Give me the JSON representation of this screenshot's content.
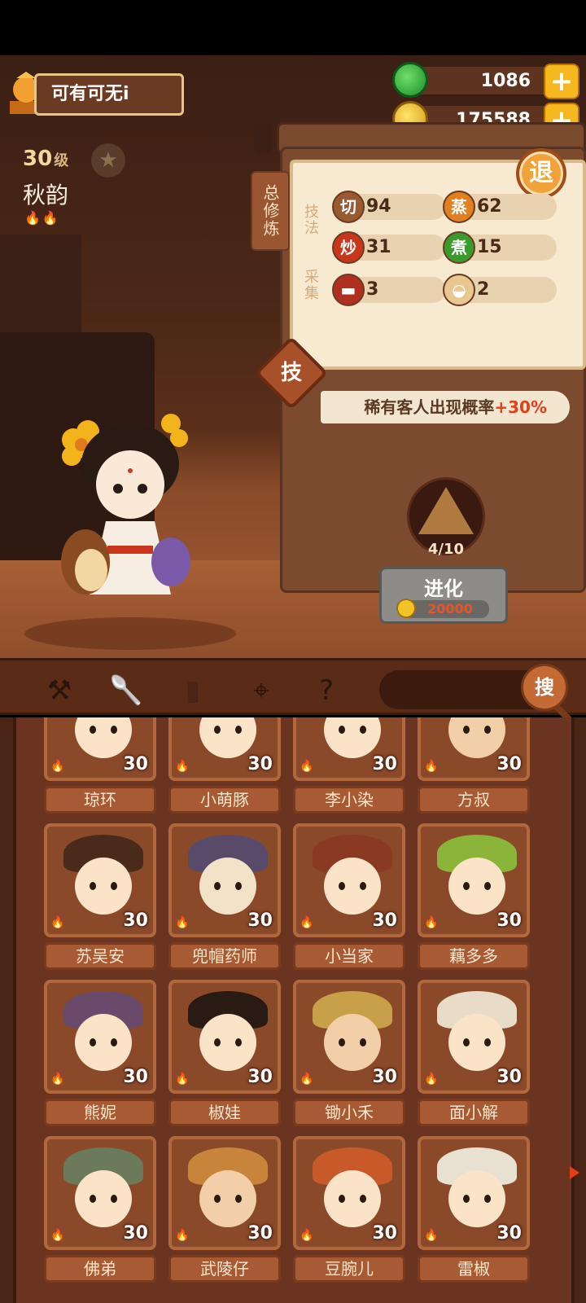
{
  "player": {
    "name": "可有可无i"
  },
  "character": {
    "level": "30",
    "level_unit": "级",
    "name": "秋韵",
    "flames": "🔥🔥"
  },
  "currency": {
    "jade": {
      "value": "1086",
      "icon": "jade-coin-icon",
      "color": "#2ca83a"
    },
    "gold": {
      "value": "175588",
      "icon": "gold-coin-icon",
      "color": "#f2c42a"
    }
  },
  "panel": {
    "tag": "总修炼",
    "retreat": "退",
    "technique_label": "技法",
    "gather_label": "采集",
    "skills": [
      {
        "icon_text": "切",
        "value": "94"
      },
      {
        "icon_text": "蒸",
        "value": "62"
      },
      {
        "icon_text": "炒",
        "value": "31"
      },
      {
        "icon_text": "煮",
        "value": "15"
      }
    ],
    "gathers": [
      {
        "icon": "meat-icon",
        "value": "3"
      },
      {
        "icon": "bun-icon",
        "value": "2"
      }
    ],
    "skill_button": "技",
    "rare_text": "稀有客人出现概率",
    "rare_pct": "+30%",
    "evolve_progress": "4/10",
    "evolve_label": "进化",
    "evolve_cost": "20000"
  },
  "tabs": [
    "shovel-icon",
    "scoop-icon",
    "jar-icon",
    "location-icon",
    "map-question-icon"
  ],
  "search": {
    "button": "搜"
  },
  "cards": [
    {
      "name": "琼环",
      "level": "30",
      "hat": "#7a3a22",
      "skin": "#fbe3c8"
    },
    {
      "name": "小萌豚",
      "level": "30",
      "hat": "#e8782a",
      "skin": "#fbe3c8"
    },
    {
      "name": "李小染",
      "level": "30",
      "hat": "#2c5a3a",
      "skin": "#fbe3c8"
    },
    {
      "name": "方叔",
      "level": "30",
      "hat": "#c87a4a",
      "skin": "#f2cfa8"
    },
    {
      "name": "苏吴安",
      "level": "30",
      "hat": "#4a2a1a",
      "skin": "#fbe3c8"
    },
    {
      "name": "兜帽药师",
      "level": "30",
      "hat": "#5a4a6a",
      "skin": "#f2e2c8"
    },
    {
      "name": "小当家",
      "level": "30",
      "hat": "#8a3a22",
      "skin": "#fbe3c8"
    },
    {
      "name": "藕多多",
      "level": "30",
      "hat": "#8ab43a",
      "skin": "#fbe3c8"
    },
    {
      "name": "熊妮",
      "level": "30",
      "hat": "#6a4a6a",
      "skin": "#fbe3c8"
    },
    {
      "name": "椒娃",
      "level": "30",
      "hat": "#2a1a14",
      "skin": "#fbe3c8"
    },
    {
      "name": "锄小禾",
      "level": "30",
      "hat": "#c8a04a",
      "skin": "#f2cfa8"
    },
    {
      "name": "面小解",
      "level": "30",
      "hat": "#e8dcc8",
      "skin": "#fbe3c8"
    },
    {
      "name": "佛弟",
      "level": "30",
      "hat": "#6a7a5a",
      "skin": "#fbe3c8"
    },
    {
      "name": "武陵仔",
      "level": "30",
      "hat": "#c8843a",
      "skin": "#f2cfa8"
    },
    {
      "name": "豆腕儿",
      "level": "30",
      "hat": "#c85a2a",
      "skin": "#fbe3c8"
    },
    {
      "name": "雷椒",
      "level": "30",
      "hat": "#e8e0d0",
      "skin": "#fbe3c8"
    }
  ]
}
